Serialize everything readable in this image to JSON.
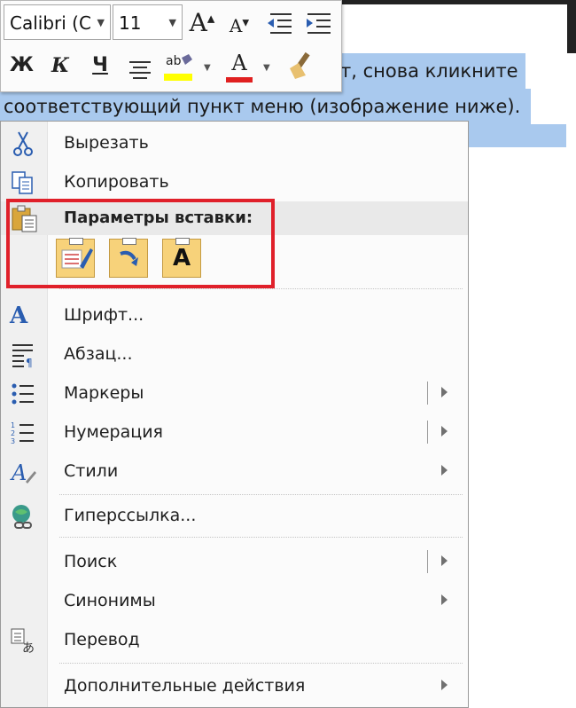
{
  "document": {
    "line1_tail": "т, снова кликните",
    "line2": "соответствующий  пункт меню (изображение ниже)."
  },
  "mini_toolbar": {
    "font_name": "Calibri (С",
    "font_size": "11",
    "bold": "Ж",
    "italic": "К",
    "underline": "Ч",
    "highlight_text": "ab",
    "font_color_letter": "A",
    "grow_font": "A",
    "shrink_font": "A"
  },
  "menu": {
    "items": [
      {
        "label": "Вырезать",
        "icon": "scissors-icon"
      },
      {
        "label": "Копировать",
        "icon": "copy-icon"
      },
      {
        "label": "Шрифт...",
        "icon": "font-icon"
      },
      {
        "label": "Абзац...",
        "icon": "paragraph-icon"
      },
      {
        "label": "Маркеры",
        "icon": "bullets-icon"
      },
      {
        "label": "Нумерация",
        "icon": "numbering-icon"
      },
      {
        "label": "Стили",
        "icon": "styles-icon"
      },
      {
        "label": "Гиперссылка...",
        "icon": "hyperlink-icon"
      },
      {
        "label": "Поиск"
      },
      {
        "label": "Синонимы"
      },
      {
        "label": "Перевод",
        "icon": "translate-icon"
      },
      {
        "label": "Дополнительные действия"
      }
    ],
    "paste_header": "Параметры вставки:",
    "paste_keep_text_letter": "A"
  },
  "colors": {
    "selection": "#a9c9ee",
    "highlight_box": "#e0202a",
    "highlighter_yellow": "#ffff00",
    "font_color_red": "#e02020"
  }
}
